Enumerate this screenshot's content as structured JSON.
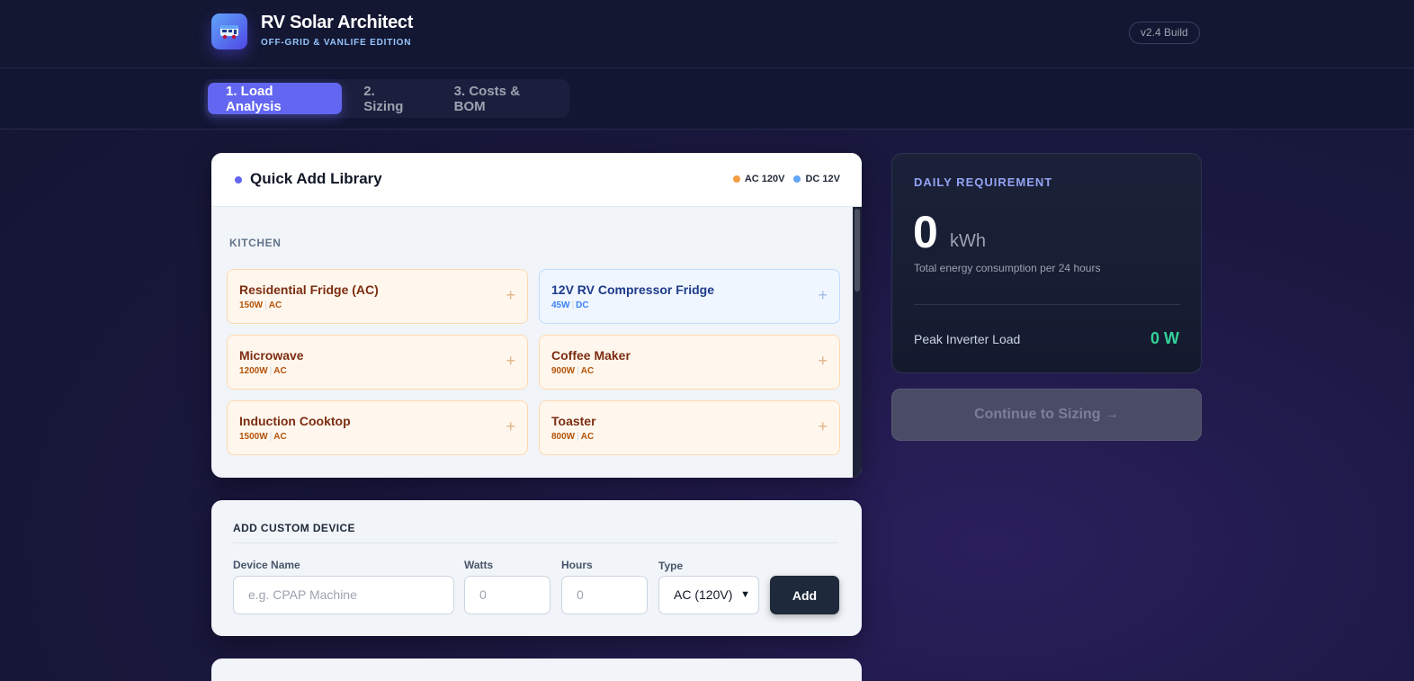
{
  "header": {
    "title": "RV Solar Architect",
    "subtitle": "OFF-GRID & VANLIFE EDITION",
    "version": "v2.4 Build"
  },
  "tabs": [
    {
      "label": "1. Load Analysis",
      "active": true
    },
    {
      "label": "2. Sizing",
      "active": false
    },
    {
      "label": "3. Costs & BOM",
      "active": false
    }
  ],
  "library": {
    "title": "Quick Add Library",
    "legend": {
      "ac": "AC 120V",
      "dc": "DC 12V"
    },
    "section": "KITCHEN",
    "devices": [
      {
        "name": "Residential Fridge (AC)",
        "watts": "150W",
        "type": "AC"
      },
      {
        "name": "12V RV Compressor Fridge",
        "watts": "45W",
        "type": "DC"
      },
      {
        "name": "Microwave",
        "watts": "1200W",
        "type": "AC"
      },
      {
        "name": "Coffee Maker",
        "watts": "900W",
        "type": "AC"
      },
      {
        "name": "Induction Cooktop",
        "watts": "1500W",
        "type": "AC"
      },
      {
        "name": "Toaster",
        "watts": "800W",
        "type": "AC"
      }
    ],
    "plus": "+"
  },
  "custom": {
    "title": "ADD CUSTOM DEVICE",
    "name_label": "Device Name",
    "name_placeholder": "e.g. CPAP Machine",
    "watts_label": "Watts",
    "watts_placeholder": "0",
    "hours_label": "Hours",
    "hours_placeholder": "0",
    "type_label": "Type",
    "type_value": "AC (120V)",
    "add_label": "Add"
  },
  "summary": {
    "label": "DAILY REQUIREMENT",
    "value": "0",
    "unit": "kWh",
    "desc": "Total energy consumption per 24 hours",
    "peak_label": "Peak Inverter Load",
    "peak_value": "0 W"
  },
  "continue_label": "Continue to Sizing →",
  "colors": {
    "accent": "#6366f1",
    "ac": "#f59e0b",
    "dc": "#60a5fa",
    "peak": "#34d399"
  }
}
